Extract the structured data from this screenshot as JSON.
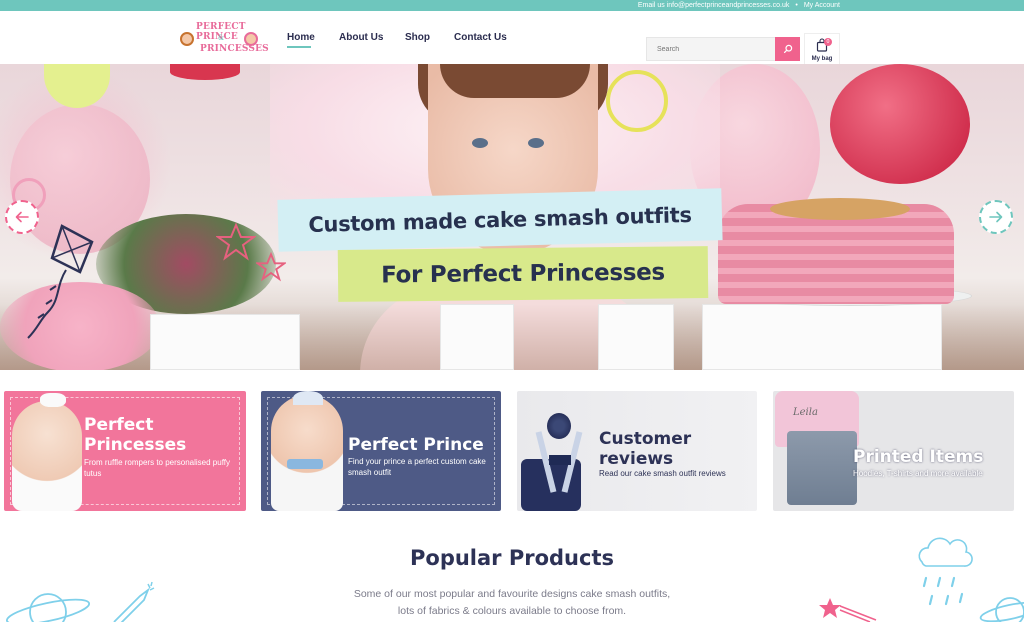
{
  "topbar": {
    "email_text": "Email us info@perfectprinceandprincesses.co.uk",
    "separator": "•",
    "account_label": "My Account"
  },
  "logo": {
    "line1": "PERFECT PRINCE",
    "amp": "&",
    "line2": "PRINCESSES"
  },
  "nav": {
    "items": [
      {
        "label": "Home"
      },
      {
        "label": "About Us"
      },
      {
        "label": "Shop"
      },
      {
        "label": "Contact Us"
      }
    ],
    "active": "Home"
  },
  "search": {
    "placeholder": "Search",
    "icon": "search-icon"
  },
  "bag": {
    "label": "My bag",
    "count": "0",
    "icon": "shopping-bag-icon"
  },
  "hero": {
    "headline": "Custom made cake smash outfits",
    "subheadline": "For Perfect Princesses",
    "prev_icon": "arrow-left-icon",
    "next_icon": "arrow-right-icon"
  },
  "categories": [
    {
      "title": "Perfect Princesses",
      "description": "From ruffle rompers to personalised puffy tutus"
    },
    {
      "title": "Perfect Prince",
      "description": "Find your prince a perfect custom cake smash outfit"
    },
    {
      "title": "Customer reviews",
      "description": "Read our cake smash outfit reviews"
    },
    {
      "title": "Printed Items",
      "description": "Hoodies, T-shirts and more available",
      "tee_print": "Leila"
    }
  ],
  "popular": {
    "title": "Popular Products",
    "line1": "Some of our most popular and favourite designs cake smash outfits,",
    "line2": "lots of fabrics & colours available to choose from."
  },
  "colors": {
    "teal": "#6ec6bd",
    "pink": "#f0628d",
    "navy": "#2d3256",
    "lime": "#d8e98b",
    "light_blue": "#d3eff4"
  }
}
